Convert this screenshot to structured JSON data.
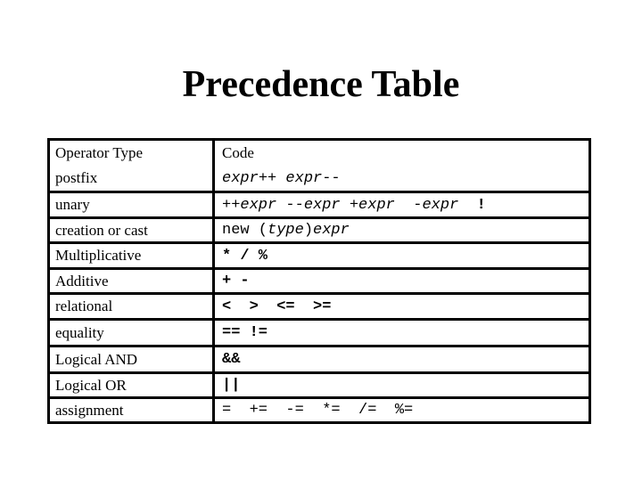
{
  "title": "Precedence Table",
  "table": {
    "headers": {
      "type": "Operator Type",
      "code": "Code"
    },
    "rows": [
      {
        "type": "postfix",
        "code": [
          {
            "t": "expr",
            "s": "it"
          },
          {
            "t": "++ ",
            "s": ""
          },
          {
            "t": "expr",
            "s": "it"
          },
          {
            "t": "--",
            "s": ""
          }
        ]
      },
      {
        "type": "unary",
        "code": [
          {
            "t": "++",
            "s": ""
          },
          {
            "t": "expr",
            "s": "it"
          },
          {
            "t": " --",
            "s": ""
          },
          {
            "t": "expr",
            "s": "it"
          },
          {
            "t": " +",
            "s": ""
          },
          {
            "t": "expr",
            "s": "it"
          },
          {
            "t": "  -",
            "s": ""
          },
          {
            "t": "expr",
            "s": "it"
          },
          {
            "t": "  !",
            "s": "bd"
          }
        ]
      },
      {
        "type": "creation or cast",
        "code": [
          {
            "t": "new (",
            "s": ""
          },
          {
            "t": "type",
            "s": "it"
          },
          {
            "t": ")",
            "s": ""
          },
          {
            "t": "expr",
            "s": "it"
          }
        ]
      },
      {
        "type": "Multiplicative",
        "code": [
          {
            "t": "* / %",
            "s": "bd"
          }
        ]
      },
      {
        "type": "Additive",
        "code": [
          {
            "t": "+ -",
            "s": "bd"
          }
        ]
      },
      {
        "type": "relational",
        "code": [
          {
            "t": "<  >  <=  >=",
            "s": "bd"
          }
        ]
      },
      {
        "type": "equality",
        "code": [
          {
            "t": "== !=",
            "s": "bd"
          }
        ]
      },
      {
        "type": "Logical AND",
        "code": [
          {
            "t": "&&",
            "s": "bd"
          }
        ]
      },
      {
        "type": "Logical OR",
        "code": [
          {
            "t": "||",
            "s": "bd"
          }
        ]
      },
      {
        "type": "assignment",
        "code": [
          {
            "t": "=  +=  -=  *=  /=  %=",
            "s": ""
          }
        ]
      }
    ]
  }
}
